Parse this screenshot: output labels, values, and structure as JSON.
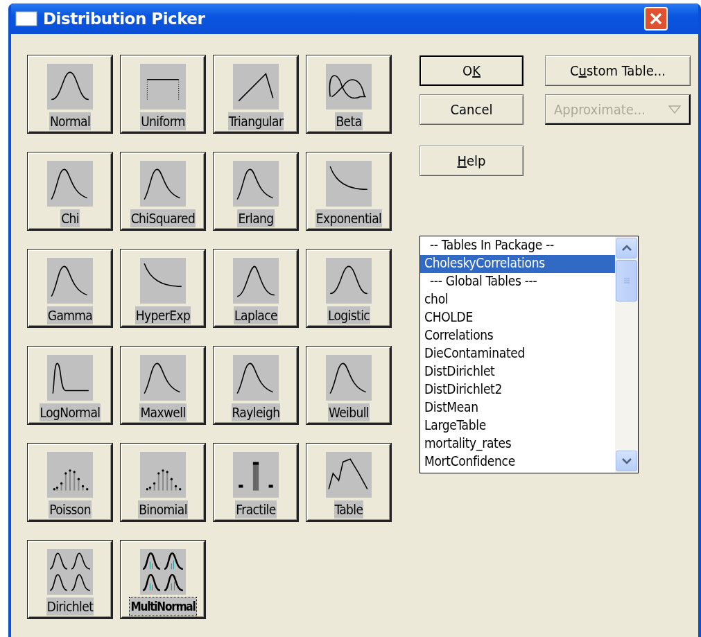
{
  "window": {
    "title": "Distribution Picker"
  },
  "distributions": [
    {
      "label": "Normal",
      "kind": "bell",
      "selected": false
    },
    {
      "label": "Uniform",
      "kind": "uniform",
      "selected": false
    },
    {
      "label": "Triangular",
      "kind": "triangular",
      "selected": false
    },
    {
      "label": "Beta",
      "kind": "beta",
      "selected": false
    },
    {
      "label": "Chi",
      "kind": "skewed",
      "selected": false
    },
    {
      "label": "ChiSquared",
      "kind": "skewed",
      "selected": false
    },
    {
      "label": "Erlang",
      "kind": "skewed",
      "selected": false
    },
    {
      "label": "Exponential",
      "kind": "decay",
      "selected": false
    },
    {
      "label": "Gamma",
      "kind": "skewed",
      "selected": false
    },
    {
      "label": "HyperExp",
      "kind": "decay",
      "selected": false
    },
    {
      "label": "Laplace",
      "kind": "spike",
      "selected": false
    },
    {
      "label": "Logistic",
      "kind": "bell",
      "selected": false
    },
    {
      "label": "LogNormal",
      "kind": "lognormal",
      "selected": false
    },
    {
      "label": "Maxwell",
      "kind": "skewed",
      "selected": false
    },
    {
      "label": "Rayleigh",
      "kind": "skewed",
      "selected": false
    },
    {
      "label": "Weibull",
      "kind": "skewed",
      "selected": false
    },
    {
      "label": "Poisson",
      "kind": "discrete",
      "selected": false
    },
    {
      "label": "Binomial",
      "kind": "discrete",
      "selected": false
    },
    {
      "label": "Fractile",
      "kind": "fractile",
      "selected": false
    },
    {
      "label": "Table",
      "kind": "table",
      "selected": false
    },
    {
      "label": "Dirichlet",
      "kind": "quad",
      "selected": false
    },
    {
      "label": "MultiNormal",
      "kind": "quad-shaded",
      "selected": true
    }
  ],
  "buttons": [
    {
      "parts": [
        {
          "text": "O",
          "underlined": false
        },
        {
          "text": "K",
          "underlined": true
        }
      ],
      "default": true,
      "disabled": false
    },
    {
      "parts": [
        {
          "text": "C",
          "underlined": false
        },
        {
          "text": "u",
          "underlined": true
        },
        {
          "text": "stom Table...",
          "underlined": false
        }
      ],
      "default": false,
      "disabled": false
    },
    {
      "parts": [
        {
          "text": "Cancel",
          "underlined": false
        }
      ],
      "default": false,
      "disabled": false
    },
    {
      "parts": [
        {
          "text": "Approximate...",
          "underlined": false
        }
      ],
      "default": false,
      "disabled": true,
      "dropdown": true
    },
    {
      "parts": [
        {
          "text": "H",
          "underlined": true
        },
        {
          "text": "elp",
          "underlined": false
        }
      ],
      "default": false,
      "disabled": false
    }
  ],
  "table_list": {
    "items": [
      {
        "text": "-- Tables In Package --",
        "kind": "header",
        "selected": false
      },
      {
        "text": "CholeskyCorrelations",
        "kind": "item",
        "selected": true
      },
      {
        "text": "--- Global Tables ---",
        "kind": "header",
        "selected": false
      },
      {
        "text": "chol",
        "kind": "item",
        "selected": false
      },
      {
        "text": "CHOLDE",
        "kind": "item",
        "selected": false
      },
      {
        "text": "Correlations",
        "kind": "item",
        "selected": false
      },
      {
        "text": "DieContaminated",
        "kind": "item",
        "selected": false
      },
      {
        "text": "DistDirichlet",
        "kind": "item",
        "selected": false
      },
      {
        "text": "DistDirichlet2",
        "kind": "item",
        "selected": false
      },
      {
        "text": "DistMean",
        "kind": "item",
        "selected": false
      },
      {
        "text": "LargeTable",
        "kind": "item",
        "selected": false
      },
      {
        "text": "mortality_rates",
        "kind": "item",
        "selected": false
      },
      {
        "text": "MortConfidence",
        "kind": "item",
        "selected": false
      }
    ]
  }
}
